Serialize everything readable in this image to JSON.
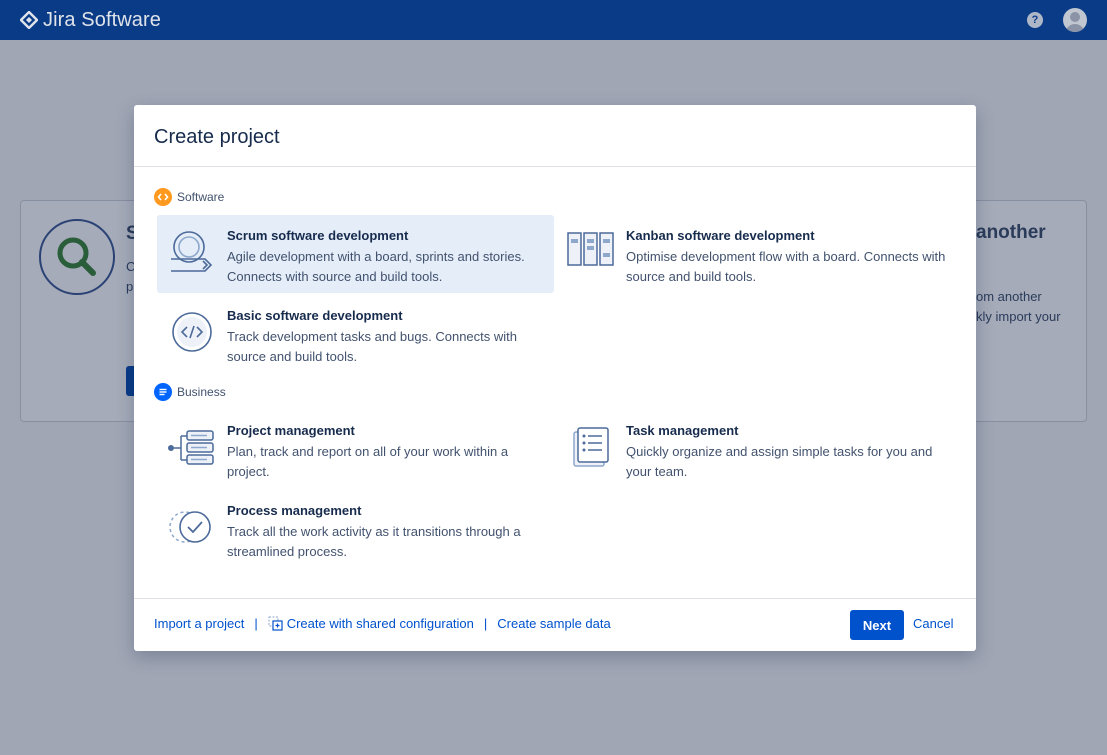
{
  "app": {
    "title": "Jira Software"
  },
  "topbar": {
    "help_icon": "question-mark-icon",
    "help_glyph": "?",
    "avatar_icon": "user-avatar-icon"
  },
  "background": {
    "left_title": "S",
    "left_line1": "C",
    "left_line2": "p",
    "right_title": "another",
    "right_line1": "om another",
    "right_line2": "kly import your"
  },
  "modal": {
    "title": "Create project",
    "sections": {
      "software": {
        "label": "Software",
        "icon": "code-brackets-icon",
        "color": "#ff991f"
      },
      "business": {
        "label": "Business",
        "icon": "document-lines-icon",
        "color": "#0065ff"
      }
    },
    "options": {
      "scrum": {
        "title": "Scrum software development",
        "description": "Agile development with a board, sprints and stories. Connects with source and build tools.",
        "icon": "scrum-cycle-icon",
        "selected": true
      },
      "kanban": {
        "title": "Kanban software development",
        "description": "Optimise development flow with a board. Connects with source and build tools.",
        "icon": "kanban-board-icon",
        "selected": false
      },
      "basic": {
        "title": "Basic software development",
        "description": "Track development tasks and bugs. Connects with source and build tools.",
        "icon": "code-circle-icon",
        "selected": false
      },
      "project": {
        "title": "Project management",
        "description": "Plan, track and report on all of your work within a project.",
        "icon": "project-list-icon",
        "selected": false
      },
      "task": {
        "title": "Task management",
        "description": "Quickly organize and assign simple tasks for you and your team.",
        "icon": "checklist-icon",
        "selected": false
      },
      "process": {
        "title": "Process management",
        "description": "Track all the work activity as it transitions through a streamlined process.",
        "icon": "check-circle-icon",
        "selected": false
      }
    },
    "footer": {
      "import_label": "Import a project",
      "shared_label": "Create with shared configuration",
      "shared_icon": "copy-config-icon",
      "sample_label": "Create sample data",
      "separator": "|",
      "next_label": "Next",
      "cancel_label": "Cancel"
    }
  },
  "colors": {
    "topbar": "#0a3b87",
    "accent": "#0052cc",
    "selected_bg": "#e4edf8",
    "overlay": "#a0a6b4"
  }
}
